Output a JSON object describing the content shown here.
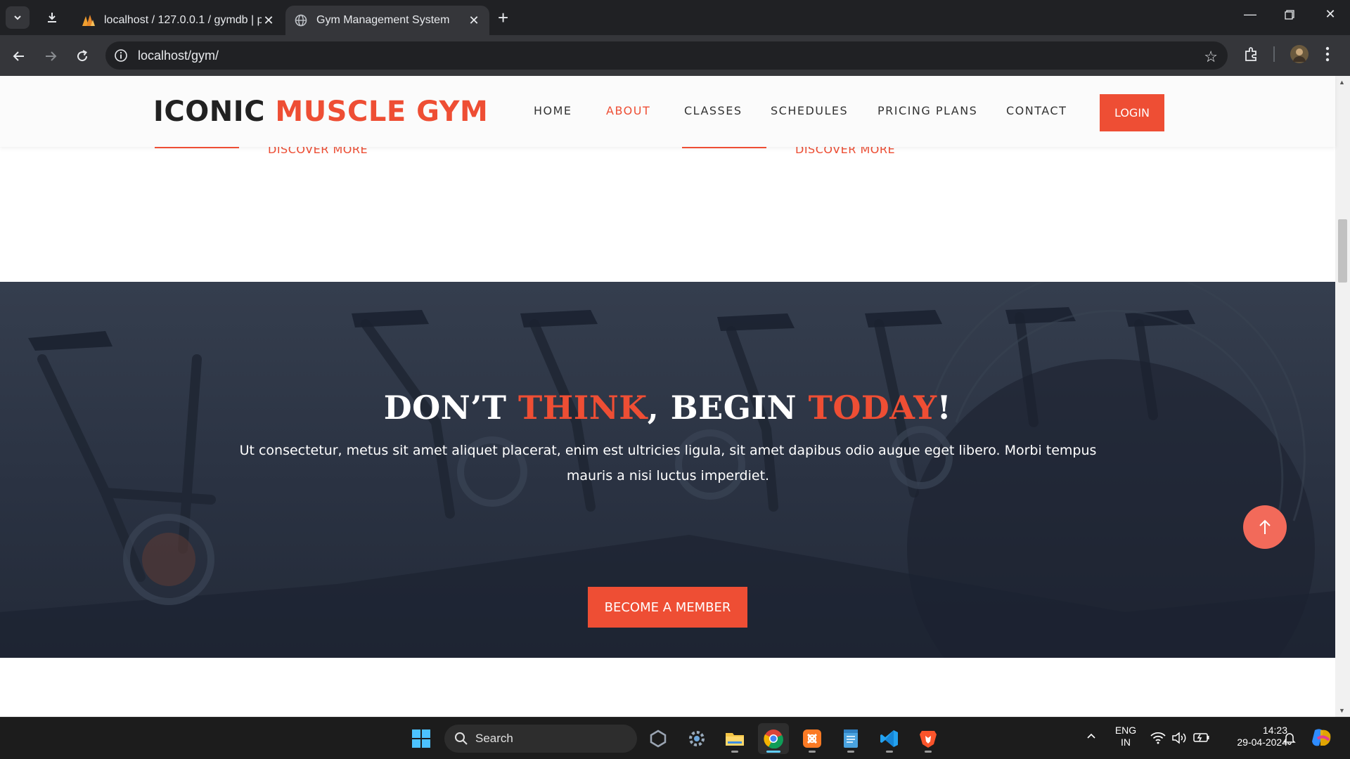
{
  "browser": {
    "tabs": [
      {
        "title": "localhost / 127.0.0.1 / gymdb | p",
        "icon": "phpmyadmin-icon",
        "active": false
      },
      {
        "title": "Gym Management System",
        "icon": "globe-icon",
        "active": true
      }
    ],
    "url": "localhost/gym/"
  },
  "site": {
    "logo_part1": "ICONIC ",
    "logo_part2": "MUSCLE GYM",
    "nav": [
      {
        "label": "HOME",
        "active": false
      },
      {
        "label": "ABOUT",
        "active": true
      },
      {
        "label": "CLASSES",
        "active": false
      },
      {
        "label": "SCHEDULES",
        "active": false
      },
      {
        "label": "PRICING PLANS",
        "active": false
      },
      {
        "label": "CONTACT",
        "active": false
      }
    ],
    "login_label": "LOGIN",
    "discover_label_1": "DISCOVER MORE",
    "discover_label_2": "DISCOVER MORE",
    "cta": {
      "title_1": "DON’T ",
      "title_2": "THINK",
      "title_3": ", BEGIN ",
      "title_4": "TODAY",
      "title_5": "!",
      "text": "Ut consectetur, metus sit amet aliquet placerat, enim est ultricies ligula, sit amet dapibus odio augue eget libero. Morbi tempus mauris a nisi luctus imperdiet.",
      "button": "BECOME A MEMBER"
    },
    "colors": {
      "accent": "#ee4e34",
      "dark_overlay": "#2a3242"
    }
  },
  "taskbar": {
    "search_label": "Search",
    "language": "ENG",
    "region": "IN",
    "time": "14:23",
    "date": "29-04-2024",
    "apps": [
      "start-icon",
      "hyper-v-icon",
      "settings-icon",
      "file-explorer-icon",
      "chrome-icon",
      "xampp-icon",
      "notepad-icon",
      "vscode-icon",
      "brave-icon"
    ]
  }
}
